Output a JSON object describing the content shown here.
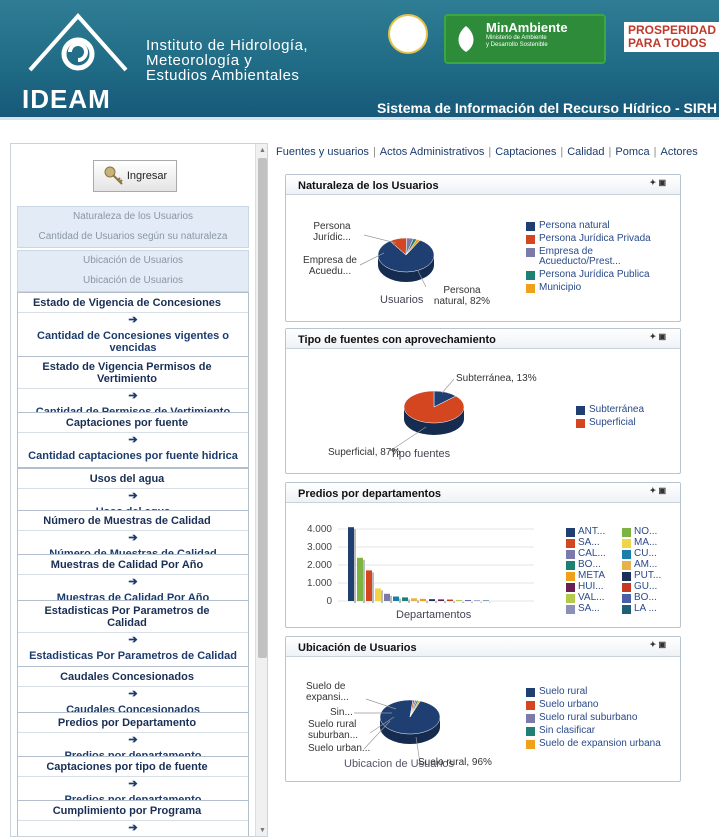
{
  "header": {
    "logo_text": "IDEAM",
    "institute_lines": [
      "Instituto de Hidrología,",
      "Meteorología y",
      "Estudios Ambientales"
    ],
    "minambiente_title": "MinAmbiente",
    "minambiente_sub": [
      "Ministerio de Ambiente",
      "y Desarrollo Sostenible"
    ],
    "prosperidad": [
      "PROSPERIDAD",
      "PARA TODOS"
    ],
    "system_name": "Sistema de Información del Recurso Hídrico - SIRH"
  },
  "sidebar": {
    "login_label": "Ingresar",
    "box1": [
      "Naturaleza de los Usuarios",
      "Cantidad de Usuarios según su naturaleza"
    ],
    "box2": [
      "Ubicación de Usuarios",
      "Ubicación de Usuarios"
    ],
    "menus": [
      {
        "h": "Estado de Vigencia de Concesiones",
        "s": "Cantidad de Concesiones vigentes o vencidas"
      },
      {
        "h": "Estado de Vigencia Permisos de Vertimiento",
        "s": "Cantidad de Permisos de Vertimiento vigentes o vencidos"
      },
      {
        "h": "Captaciones por fuente",
        "s": "Cantidad captaciones por fuente hidrica"
      },
      {
        "h": "Usos del agua",
        "s": "Usos del agua"
      },
      {
        "h": "Número de Muestras de Calidad",
        "s": "Número de Muestras de Calidad"
      },
      {
        "h": "Muestras de Calidad Por Año",
        "s": "Muestras de Calidad Por Año"
      },
      {
        "h": "Estadisticas Por Parametros de Calidad",
        "s": "Estadisticas Por Parametros de Calidad"
      },
      {
        "h": "Caudales Concesionados",
        "s": "Caudales Concesionados"
      },
      {
        "h": "Predios por Departamento",
        "s": "Predios por departamento"
      },
      {
        "h": "Captaciones por tipo de fuente",
        "s": "Predios por departamento"
      },
      {
        "h": "Cumplimiento por Programa",
        "s": "Cumplimiento por Programa"
      }
    ]
  },
  "tabs": [
    "Fuentes y usuarios",
    "Actos Administrativos",
    "Captaciones",
    "Calidad",
    "Pomca",
    "Actores"
  ],
  "panels": {
    "p1": {
      "title": "Naturaleza de los Usuarios",
      "center_label": "Usuarios",
      "slice_labels": [
        "Persona Jurídic...",
        "Empresa de Acuedu...",
        "Persona natural, 82%"
      ],
      "legend": [
        {
          "label": "Persona natural",
          "color": "#1f3f73"
        },
        {
          "label": "Persona Jurídica Privada",
          "color": "#d3461f"
        },
        {
          "label": "Empresa de Acueducto/Prest...",
          "color": "#7b7aa8"
        },
        {
          "label": "Persona Jurídica Publica",
          "color": "#1e7f73"
        },
        {
          "label": "Municipio",
          "color": "#f0a11c"
        }
      ]
    },
    "p2": {
      "title": "Tipo de fuentes con aprovechamiento",
      "center_label": "Tipo fuentes",
      "slice_labels": [
        "Subterránea, 13%",
        "Superficial, 87%"
      ],
      "legend": [
        {
          "label": "Subterránea",
          "color": "#1f3f73"
        },
        {
          "label": "Superficial",
          "color": "#d3461f"
        }
      ]
    },
    "p3": {
      "title": "Predios por departamentos",
      "xlabel": "Departamentos",
      "yticks": [
        "4.000",
        "3.000",
        "2.000",
        "1.000",
        "0"
      ],
      "legend": [
        {
          "label": "ANT...",
          "color": "#1f3f73"
        },
        {
          "label": "NO...",
          "color": "#7cb342"
        },
        {
          "label": "SA...",
          "color": "#d3461f"
        },
        {
          "label": "MA...",
          "color": "#f2d44a"
        },
        {
          "label": "CAL...",
          "color": "#7b7aa8"
        },
        {
          "label": "CU...",
          "color": "#1a7fa8"
        },
        {
          "label": "BO...",
          "color": "#1e7f73"
        },
        {
          "label": "AM...",
          "color": "#e8b24a"
        },
        {
          "label": "META",
          "color": "#f0a11c"
        },
        {
          "label": "PUT...",
          "color": "#1b2f5a"
        },
        {
          "label": "HUI...",
          "color": "#6a1f52"
        },
        {
          "label": "GU...",
          "color": "#c23b22"
        },
        {
          "label": "VAL...",
          "color": "#b5c94a"
        },
        {
          "label": "BO...",
          "color": "#4a5fa8"
        },
        {
          "label": "SA...",
          "color": "#8c8fb8"
        },
        {
          "label": "LA ...",
          "color": "#1e5f73"
        }
      ]
    },
    "p4": {
      "title": "Ubicación de Usuarios",
      "center_label": "Ubicacion de Usuarios",
      "slice_labels": [
        "Suelo de expansi...",
        "Sin...",
        "Suelo rural suburban...",
        "Suelo urban...",
        "Suelo rural, 96%"
      ],
      "legend": [
        {
          "label": "Suelo rural",
          "color": "#1f3f73"
        },
        {
          "label": "Suelo urbano",
          "color": "#d3461f"
        },
        {
          "label": "Suelo rural suburbano",
          "color": "#7b7aa8"
        },
        {
          "label": "Sin clasificar",
          "color": "#1e7f73"
        },
        {
          "label": "Suelo de expansion urbana",
          "color": "#f0a11c"
        }
      ]
    }
  },
  "chart_data": [
    {
      "type": "pie",
      "title": "Naturaleza de los Usuarios",
      "categories": [
        "Persona natural",
        "Persona Jurídica Privada",
        "Empresa de Acueducto/Prest...",
        "Persona Jurídica Publica",
        "Municipio"
      ],
      "values": [
        82,
        10,
        4,
        2,
        2
      ]
    },
    {
      "type": "pie",
      "title": "Tipo de fuentes con aprovechamiento",
      "categories": [
        "Subterránea",
        "Superficial"
      ],
      "values": [
        13,
        87
      ]
    },
    {
      "type": "bar",
      "title": "Predios por departamentos",
      "xlabel": "Departamentos",
      "categories": [
        "ANT...",
        "NO...",
        "SA...",
        "MA...",
        "CAL...",
        "CU...",
        "BO...",
        "AM...",
        "META",
        "PUT...",
        "HUI...",
        "GU...",
        "VAL...",
        "BO...",
        "SA...",
        "LA ..."
      ],
      "values": [
        4100,
        2400,
        1700,
        700,
        400,
        250,
        200,
        150,
        120,
        100,
        90,
        80,
        60,
        50,
        40,
        30
      ],
      "ylim": [
        0,
        4000
      ]
    },
    {
      "type": "pie",
      "title": "Ubicación de Usuarios",
      "categories": [
        "Suelo rural",
        "Suelo urbano",
        "Suelo rural suburbano",
        "Sin clasificar",
        "Suelo de expansion urbana"
      ],
      "values": [
        96,
        1,
        1,
        1,
        1
      ]
    }
  ]
}
